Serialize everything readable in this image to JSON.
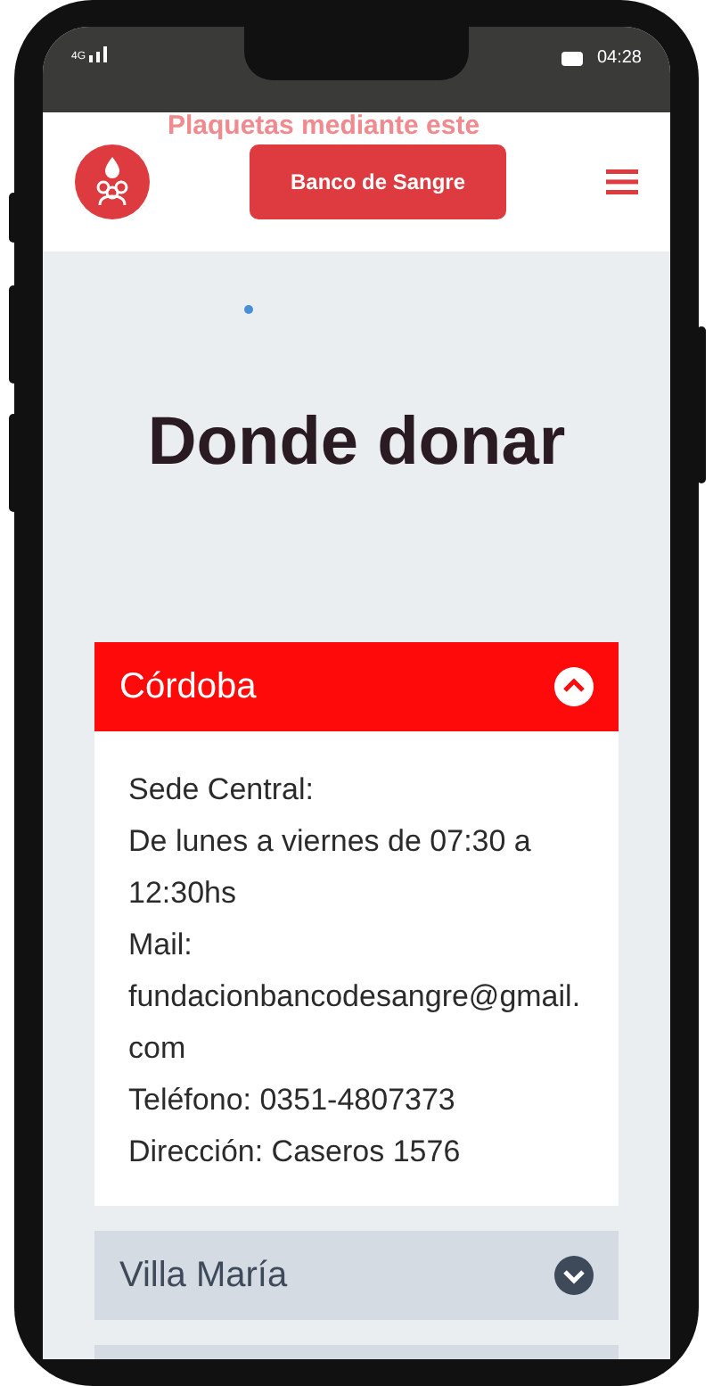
{
  "status_bar": {
    "network": "4G",
    "time": "04:28"
  },
  "header": {
    "faded_text": "Plaquetas mediante este",
    "button": "Banco de Sangre"
  },
  "title": "Donde donar",
  "accordion": [
    {
      "title": "Córdoba",
      "expanded": true,
      "lines": [
        "Sede Central:",
        "De lunes a viernes de 07:30 a 12:30hs",
        "Mail:",
        "fundacionbancodesangre@gmail.com",
        "Teléfono: 0351-4807373",
        "Dirección: Caseros 1576"
      ]
    },
    {
      "title": "Villa María",
      "expanded": false
    }
  ]
}
